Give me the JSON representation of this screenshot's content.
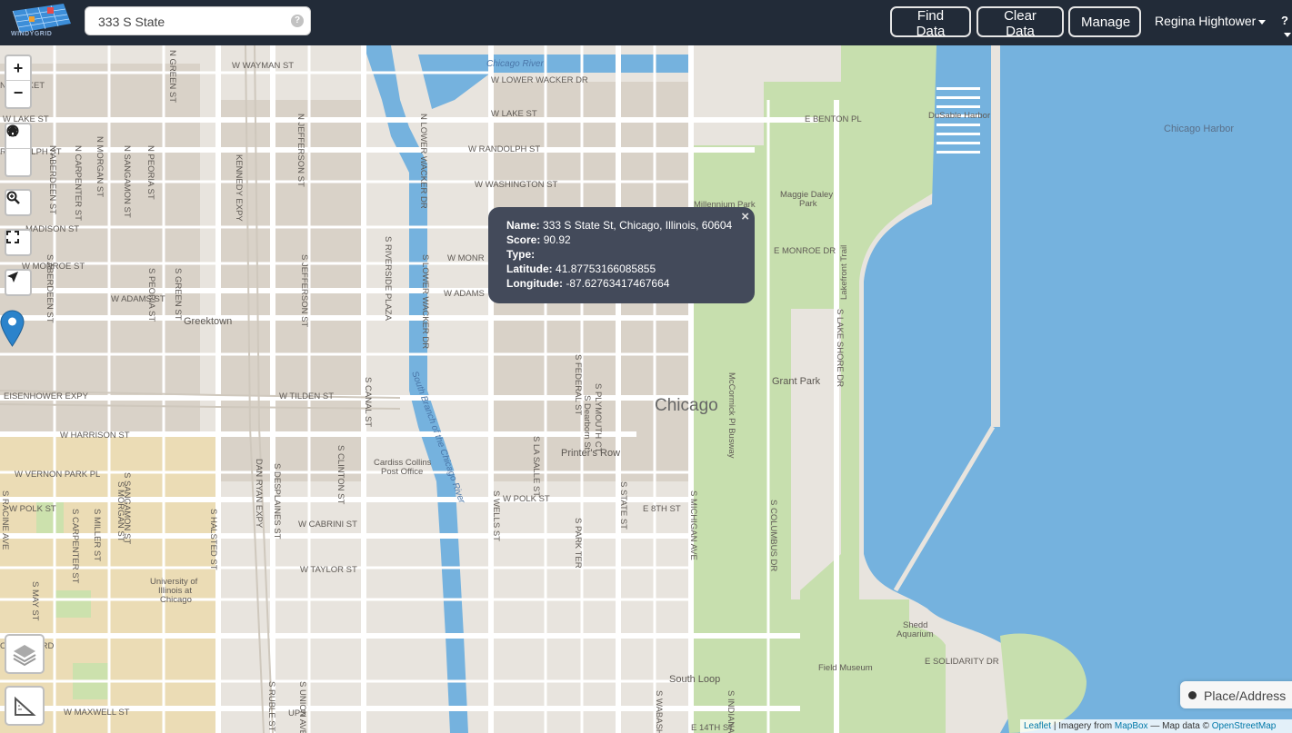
{
  "app": {
    "logo_text": "WINDYGRID"
  },
  "search": {
    "value": "333 S State",
    "help_icon": "?"
  },
  "nav": {
    "find_label": "Find Data",
    "clear_label": "Clear Data",
    "manage_label": "Manage",
    "user_name": "Regina Hightower",
    "help_icon": "?"
  },
  "controls": {
    "zoom_in": "+",
    "zoom_out": "−"
  },
  "popup": {
    "name_label": "Name:",
    "name_value": "333 S State St, Chicago, Illinois, 60604",
    "score_label": "Score:",
    "score_value": "90.92",
    "type_label": "Type:",
    "type_value": "",
    "lat_label": "Latitude:",
    "lat_value": "41.87753166085855",
    "lon_label": "Longitude:",
    "lon_value": "-87.62763417467664",
    "close": "×"
  },
  "legend": {
    "label": "Place/Address"
  },
  "attribution": {
    "leaflet": "Leaflet",
    "imagery": "| Imagery from",
    "mapbox": "MapBox",
    "mapdata": "— Map data ©",
    "osm": "OpenStreetMap"
  },
  "map_labels": {
    "chicago_river": "Chicago River",
    "w_lower_wacker": "W LOWER WACKER DR",
    "w_lake_st_left": "W LAKE ST",
    "w_lake_st": "W LAKE ST",
    "w_randolph": "W RANDOLPH ST",
    "randolph_left": "RANDOLPH ST",
    "w_washington": "W WASHINGTON ST",
    "w_madison": "MADISON ST",
    "w_monroe_left": "W MONROE ST",
    "w_monroe": "W MONR",
    "e_monroe": "E MONROE DR",
    "w_adams_left": "W ADAMS ST",
    "w_adams": "W ADAMS",
    "greektown": "Greektown",
    "eisenhower": "EISENHOWER EXPY",
    "w_tilden": "W TILDEN ST",
    "w_harrison": "W HARRISON ST",
    "w_vernon_park": "W VERNON PARK PL",
    "w_polk_left": "W POLK ST",
    "w_polk": "W POLK ST",
    "w_cabrini": "W CABRINI ST",
    "w_taylor": "W TAYLOR ST",
    "roosevelt": "OSEVELT RD",
    "w_maxwell": "W MAXWELL ST",
    "w_wayman": "W WAYMAN ST",
    "fulton_market": "N MARKET",
    "chicago_city": "Chicago",
    "printers_row": "Printer's Row",
    "cardiss1": "Cardiss Collins",
    "cardiss2": "Post Office",
    "uic1": "University of",
    "uic2": "Illinois at",
    "uic3": "Chicago",
    "south_loop": "South Loop",
    "grant_park": "Grant Park",
    "millennium": "Millennium Park",
    "maggie1": "Maggie Daley",
    "maggie2": "Park",
    "dusable": "DuSable Harbor",
    "chicago_harbor": "Chicago Harbor",
    "e_benton": "E BENTON PL",
    "shedd1": "Shedd",
    "shedd2": "Aquarium",
    "field": "Field Museum",
    "e_solidarity": "E SOLIDARITY DR",
    "e_8th": "E 8TH ST",
    "e_14th": "E 14TH ST",
    "lakefront_trail": "Lakefront Trail",
    "s_lake_shore": "S LAKE SHORE DR",
    "s_columbus": "S COLUMBUS DR",
    "s_michigan": "S MICHIGAN AVE",
    "s_state": "S STATE ST",
    "s_wells": "S WELLS ST",
    "s_clinton": "S CLINTON ST",
    "s_canal": "S CANAL ST",
    "s_jefferson": "S JEFFERSON ST",
    "s_desplaines": "S DESPLAINES ST",
    "dan_ryan": "DAN RYAN EXPY",
    "kennedy": "KENNEDY EXPY",
    "s_halsted": "S HALSTED ST",
    "n_wacker": "N LOWER WACKER DR",
    "s_wacker": "S LOWER WACKER DR",
    "riverside": "S RIVERSIDE PLAZA",
    "s_federal": "S FEDERAL ST",
    "s_dearborn": "S Dearborn St",
    "s_plymouth": "S PLYMOUTH CT",
    "s_lasalle": "S LA SALLE ST",
    "s_park_ter": "S PARK TER",
    "s_morgan": "S MORGAN ST",
    "s_racine": "S RACINE AVE",
    "s_carpenter": "S CARPENTER ST",
    "mccormick": "McCormick Pl Busway",
    "south_branch": "South Branch of the Chicago River",
    "s_union": "S UNION AVE",
    "s_ruble": "S RUBLE ST",
    "n_jefferson": "N JEFFERSON ST",
    "n_morgan": "N MORGAN ST",
    "n_green": "N GREEN ST",
    "n_peoria": "N PEORIA ST",
    "n_sangamon": "N SANGAMON ST",
    "n_carpenter": "N CARPENTER ST",
    "n_aberdeen": "N ABERDEEN ST",
    "ups": "UPS",
    "s_aberdeen": "S ABERDEEN ST",
    "s_green": "S GREEN ST",
    "s_peoria": "S PEORIA ST",
    "s_sangamon": "S SANGAMON ST",
    "s_may": "S MAY ST",
    "s_miller": "S MILLER ST",
    "s_indiana": "S INDIANA",
    "s_wabash": "S WABASH"
  },
  "colors": {
    "navbar": "#222b38",
    "water": "#75b2de",
    "land": "#e8e4de",
    "park": "#c7dfae",
    "popup": "#434a5a",
    "marker": "#2b83cb"
  }
}
